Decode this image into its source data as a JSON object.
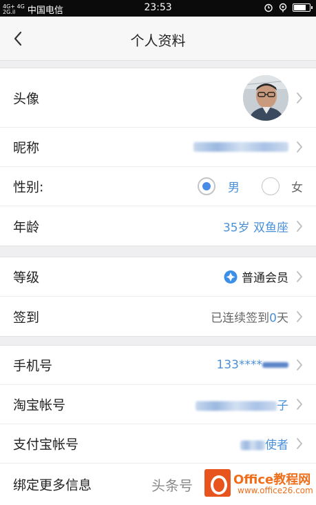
{
  "status_bar": {
    "network_top": "4G+ 4G",
    "network_bottom": "2G.il",
    "carrier": "中国电信",
    "time": "23:53",
    "battery_level": 0.85
  },
  "nav": {
    "title": "个人资料"
  },
  "profile": {
    "avatar_label": "头像",
    "nickname_label": "昵称",
    "gender_label": "性别:",
    "gender_male": "男",
    "gender_female": "女",
    "gender_selected": "男",
    "age_label": "年龄",
    "age_value": "35岁 双鱼座"
  },
  "membership": {
    "level_label": "等级",
    "level_value": "普通会员",
    "checkin_label": "签到",
    "checkin_prefix": "已连续签到",
    "checkin_count": "0",
    "checkin_suffix": "天"
  },
  "accounts": {
    "phone_label": "手机号",
    "phone_value": "133****",
    "taobao_label": "淘宝帐号",
    "taobao_value_tail": "子",
    "alipay_label": "支付宝帐号",
    "alipay_value_tail": "使者",
    "more_label": "绑定更多信息"
  },
  "watermark": {
    "text": "头条号",
    "logo_title": "Office教程网",
    "logo_url": "www.office26.com"
  },
  "colors": {
    "accent": "#4a90d9",
    "radio_checked": "#4a8ae8",
    "logo_orange": "#e8541e"
  }
}
